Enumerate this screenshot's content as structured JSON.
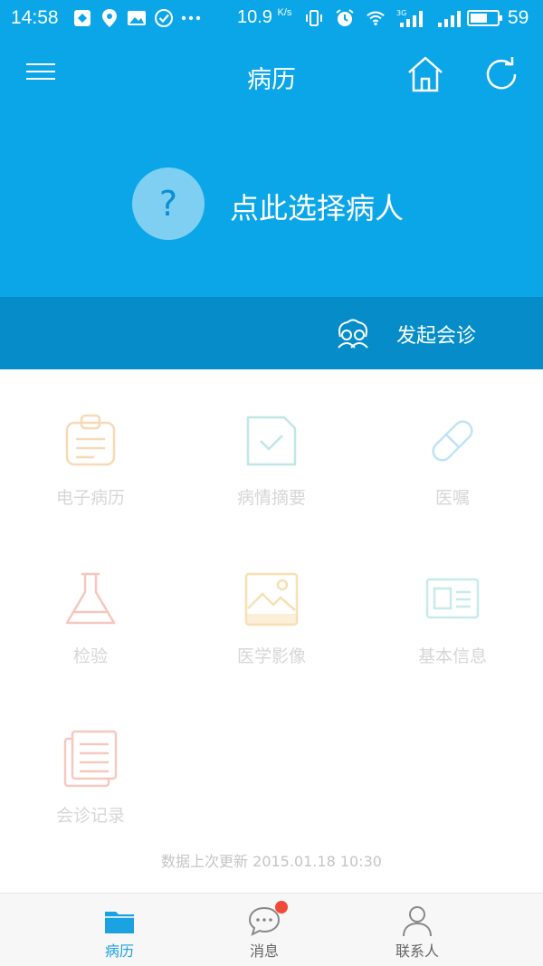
{
  "status_bar": {
    "time": "14:58",
    "net_speed": "10.9",
    "net_speed_unit": "K/s",
    "signal_type": "3G",
    "battery": "59"
  },
  "nav": {
    "title": "病历",
    "menu_icon": "hamburger-icon",
    "home_icon": "home-icon",
    "refresh_icon": "refresh-icon"
  },
  "patient": {
    "placeholder_icon": "?",
    "label": "点此选择病人"
  },
  "consult": {
    "label": "发起会诊",
    "icon": "group-icon"
  },
  "grid": {
    "items": [
      {
        "label": "电子病历",
        "icon": "clipboard-icon",
        "color": "#f7d9b6"
      },
      {
        "label": "病情摘要",
        "icon": "checked-document-icon",
        "color": "#bfe7e6"
      },
      {
        "label": "医嘱",
        "icon": "pill-icon",
        "color": "#bfe4f4"
      },
      {
        "label": "检验",
        "icon": "flask-icon",
        "color": "#f5c7be"
      },
      {
        "label": "医学影像",
        "icon": "image-icon",
        "color": "#f7e0b3"
      },
      {
        "label": "基本信息",
        "icon": "id-card-icon",
        "color": "#c7eaea"
      },
      {
        "label": "会诊记录",
        "icon": "records-icon",
        "color": "#f5c9bf"
      }
    ]
  },
  "footer": {
    "update_text": "数据上次更新 2015.01.18 10:30"
  },
  "tabs": [
    {
      "label": "病历",
      "icon": "folder-icon",
      "active": true
    },
    {
      "label": "消息",
      "icon": "chat-icon",
      "active": false,
      "badge": true
    },
    {
      "label": "联系人",
      "icon": "person-icon",
      "active": false
    }
  ],
  "colors": {
    "primary": "#0aa6e8",
    "primary_dark": "#068dc9",
    "tab_active": "#1ba2e0",
    "badge": "#f24a3a"
  }
}
